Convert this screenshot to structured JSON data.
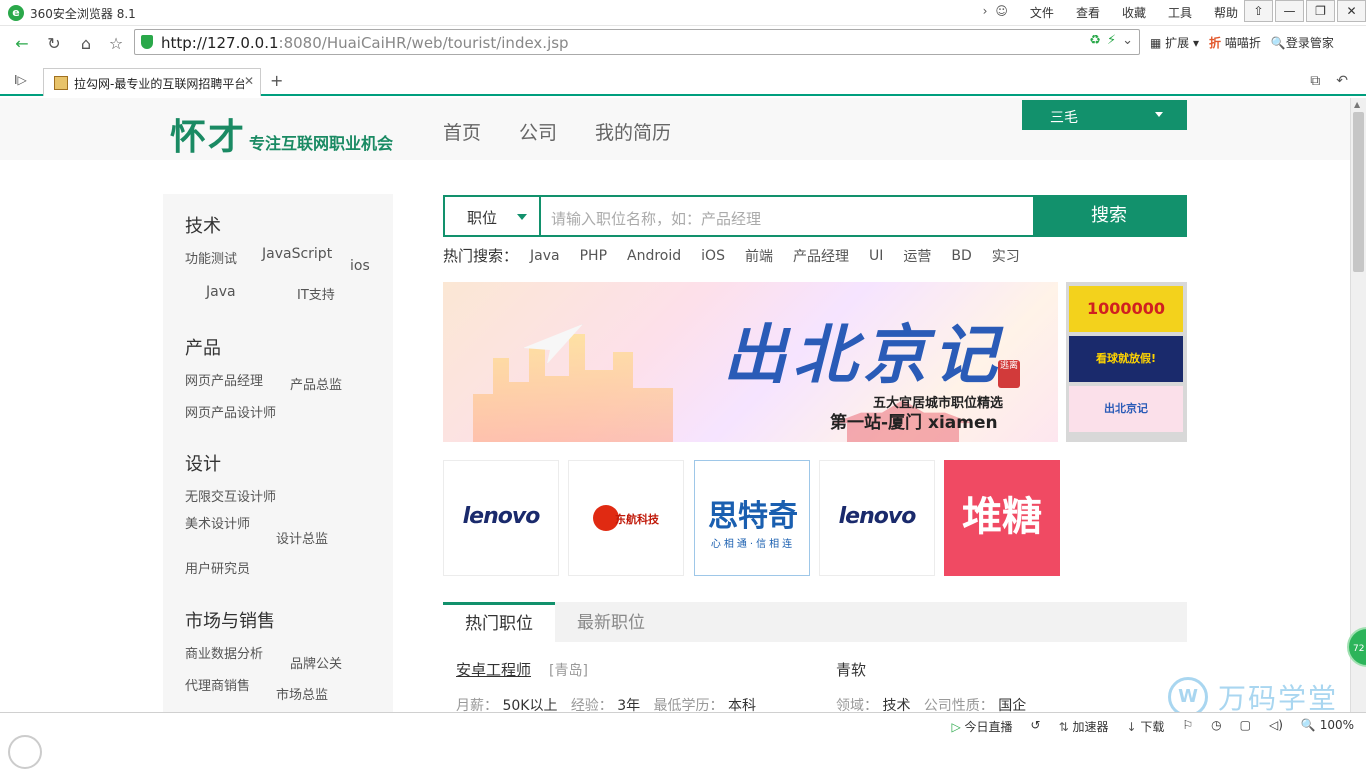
{
  "browser": {
    "title": "360安全浏览器 8.1",
    "menu": [
      "文件",
      "查看",
      "收藏",
      "工具",
      "帮助"
    ],
    "window_buttons": [
      "⇧",
      "—",
      "❐",
      "✕"
    ],
    "url_host": "http://127.0.0.1",
    "url_rest": ":8080/HuaiCaiHR/web/tourist/index.jsp",
    "right_tools": [
      "扩展",
      "喵喵折",
      "登录管家"
    ],
    "tab_title": "拉勾网-最专业的互联网招聘平台",
    "status_items": [
      "今日直播",
      "加速器",
      "下载",
      "100%"
    ]
  },
  "site": {
    "brand": "怀才",
    "slogan": "专注互联网职业机会",
    "nav": [
      "首页",
      "公司",
      "我的简历"
    ],
    "user": "三毛"
  },
  "sidebar": {
    "categories": [
      {
        "title": "技术",
        "items": [
          "功能测试",
          "JavaScript",
          "ios",
          "Java",
          "IT支持"
        ]
      },
      {
        "title": "产品",
        "items": [
          "网页产品经理",
          "产品总监",
          "网页产品设计师"
        ]
      },
      {
        "title": "设计",
        "items": [
          "无限交互设计师",
          "美术设计师",
          "设计总监",
          "用户研究员"
        ]
      },
      {
        "title": "市场与销售",
        "items": [
          "商业数据分析",
          "品牌公关",
          "代理商销售",
          "市场总监"
        ]
      }
    ]
  },
  "search": {
    "select": "职位",
    "placeholder": "请输入职位名称，如：产品经理",
    "button": "搜索",
    "hot_label": "热门搜索：",
    "hot": [
      "Java",
      "PHP",
      "Android",
      "iOS",
      "前端",
      "产品经理",
      "UI",
      "运营",
      "BD",
      "实习"
    ]
  },
  "banner": {
    "headline": "出北京记",
    "seal": "逃离",
    "sub1": "五大宜居城市职位精选",
    "sub2": "第一站-厦门 xiamen",
    "thumbs": [
      "1000000",
      "看球就放假!",
      "出北京记"
    ]
  },
  "logos": [
    "lenovo",
    "东航科技",
    "思特奇",
    "心相通·信相连",
    "lenovo",
    "堆糖"
  ],
  "jobs": {
    "tabs": [
      "热门职位",
      "最新职位"
    ],
    "items": [
      {
        "title": "安卓工程师",
        "city": "[青岛]",
        "company": "青软",
        "salary_label": "月薪：",
        "salary": "50K以上",
        "exp_label": "经验：",
        "exp": "3年",
        "edu_label": "最低学历：",
        "edu": "本科",
        "field_label": "领域：",
        "field": "技术",
        "type_label": "公司性质：",
        "type": "国企"
      }
    ]
  },
  "overlay": {
    "watermark": "万码学堂",
    "float_badge": "72"
  },
  "colors": {
    "accent": "#12916c",
    "brand_green": "#1a8a63",
    "duitang": "#f04a63"
  }
}
